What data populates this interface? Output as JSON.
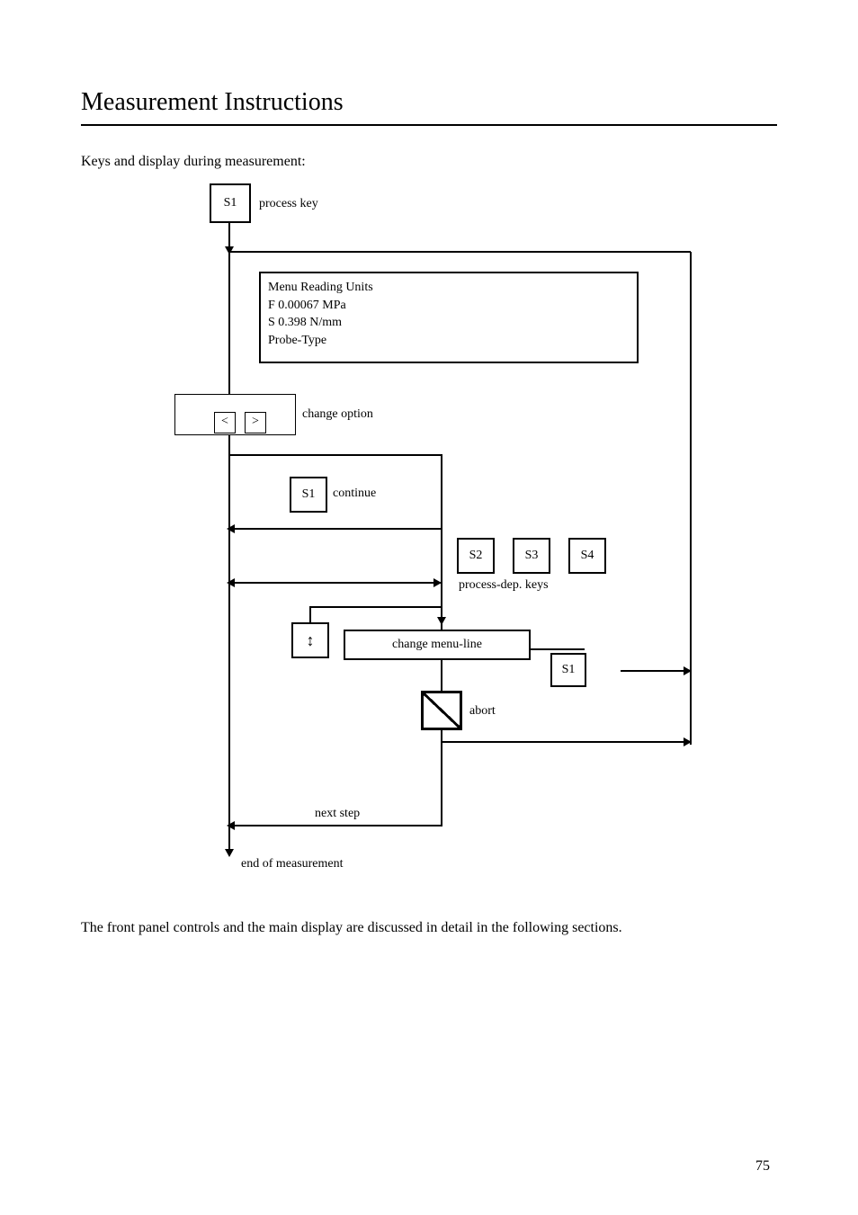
{
  "header": {
    "title": "Measurement Instructions",
    "intro": "Keys and display during measurement:"
  },
  "footer": {
    "outro": "The front panel controls and the main display are discussed in detail in the following sections.",
    "page": "75"
  },
  "diagram": {
    "process_key": "S1",
    "lcd": {
      "line1": "Menu  Reading             Units",
      "line2": "F      0.00067    MPa",
      "line3": "S      0.398      N/mm",
      "line4": "        Probe-Type"
    },
    "change_option": {
      "left": "<",
      "right": ">",
      "label": "change option"
    },
    "continue_key": "S1",
    "process_keys": {
      "k1": "S2",
      "k2": "S3",
      "k3": "S4",
      "label": "process-dep. keys"
    },
    "change_menu": {
      "key": "↕",
      "box": "change menu-line",
      "end_key": "S1"
    },
    "abort_label": "abort",
    "step_label": "next step",
    "end_label": "end of measurement"
  }
}
